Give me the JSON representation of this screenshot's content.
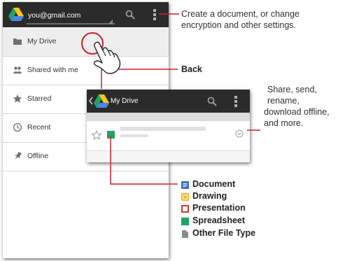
{
  "back_screen": {
    "account": "you@gmail.com",
    "nav_items": [
      {
        "label": "My Drive",
        "icon": "folder-icon"
      },
      {
        "label": "Shared with me",
        "icon": "people-icon"
      },
      {
        "label": "Starred",
        "icon": "star-icon"
      },
      {
        "label": "Recent",
        "icon": "clock-icon"
      },
      {
        "label": "Offline",
        "icon": "pin-icon"
      }
    ]
  },
  "front_screen": {
    "title": "My Drive"
  },
  "callouts": {
    "menu": "Create a document, or change encryption and other settings.",
    "menu_line1": "Create a document, or change",
    "menu_line2": "encryption and other settings.",
    "back": "Back",
    "more_line1": "Share, send,",
    "more_line2": "rename,",
    "more_line3": "download offline,",
    "more_line4": "and more."
  },
  "legend": [
    {
      "label": "Document",
      "color": "#3d6fc4"
    },
    {
      "label": "Drawing",
      "color": "#f2b632"
    },
    {
      "label": "Presentation",
      "color": "#d83a2e"
    },
    {
      "label": "Spreadsheet",
      "color": "#1ea362"
    },
    {
      "label": "Other File Type",
      "color": "#8a8a8a"
    }
  ],
  "colors": {
    "callout_line": "#cf1f2e",
    "drive_blue": "#4a86e8",
    "drive_yellow": "#f7c51f",
    "drive_green": "#1fa463"
  }
}
